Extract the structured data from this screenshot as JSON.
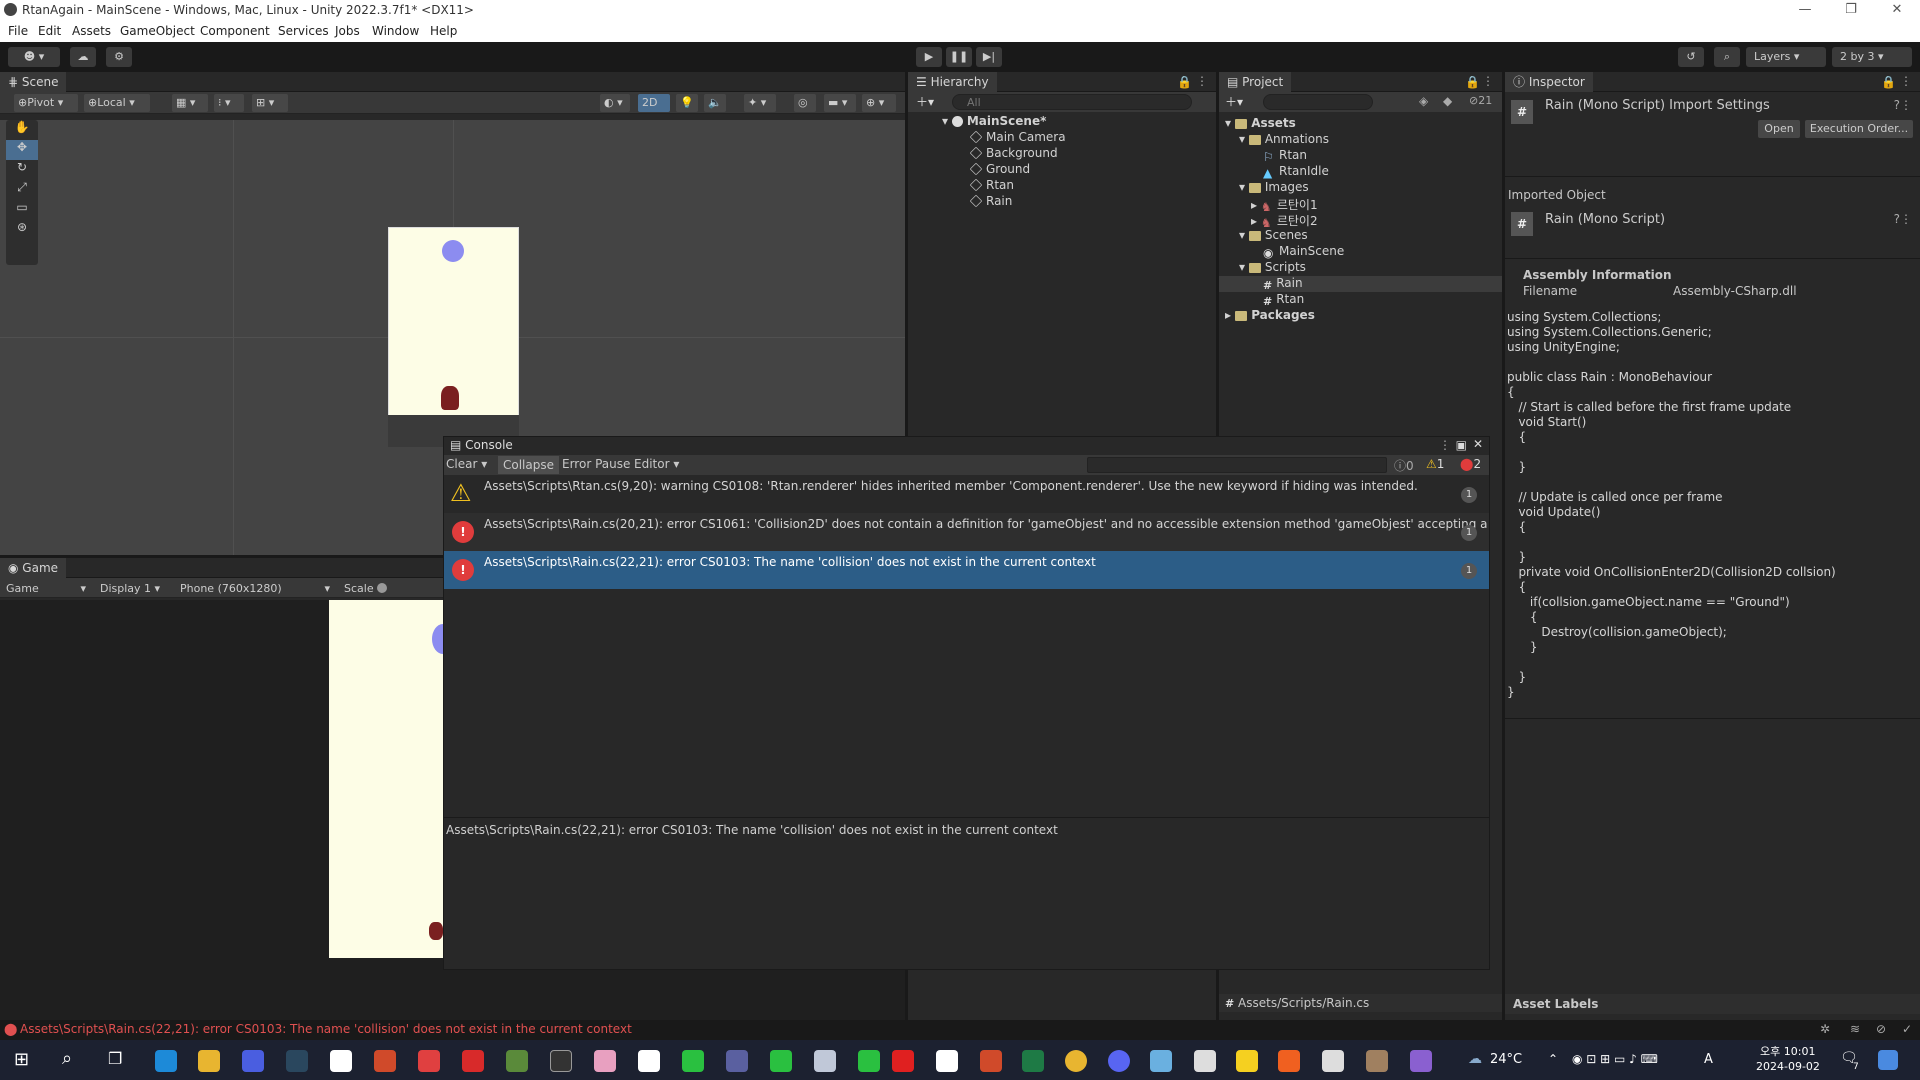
{
  "window": {
    "title": "RtanAgain - MainScene - Windows, Mac, Linux - Unity 2022.3.7f1* <DX11>"
  },
  "menu": [
    "File",
    "Edit",
    "Assets",
    "GameObject",
    "Component",
    "Services",
    "Jobs",
    "Window",
    "Help"
  ],
  "toolbar": {
    "layers": "Layers",
    "layout": "2 by 3"
  },
  "scene": {
    "tab": "Scene",
    "pivot": "Pivot",
    "local": "Local",
    "mode2d": "2D"
  },
  "game": {
    "tab": "Game",
    "view": "Game",
    "display": "Display 1",
    "resolution": "Phone (760x1280)",
    "scale": "Scale"
  },
  "hierarchy": {
    "tab": "Hierarchy",
    "search_placeholder": "All",
    "scene_name": "MainScene*",
    "items": [
      "Main Camera",
      "Background",
      "Ground",
      "Rtan",
      "Rain"
    ]
  },
  "project": {
    "tab": "Project",
    "hidden_count": "21",
    "root": "Assets",
    "tree": {
      "animations": "Anmations",
      "anim_items": [
        "Rtan",
        "RtanIdle"
      ],
      "images": "Images",
      "image_items": [
        "르탄이1",
        "르탄이2"
      ],
      "scenes": "Scenes",
      "scene_items": [
        "MainScene"
      ],
      "scripts": "Scripts",
      "script_items": [
        "Rain",
        "Rtan"
      ],
      "packages": "Packages"
    },
    "footer_path": "Assets/Scripts/Rain.cs"
  },
  "inspector": {
    "tab": "Inspector",
    "title": "Rain (Mono Script) Import Settings",
    "open_label": "Open",
    "exec_order_label": "Execution Order...",
    "imported_object": "Imported Object",
    "object_name": "Rain (Mono Script)",
    "assembly_info": "Assembly Information",
    "filename_label": "Filename",
    "filename_value": "Assembly-CSharp.dll",
    "code": "using System.Collections;\nusing System.Collections.Generic;\nusing UnityEngine;\n\npublic class Rain : MonoBehaviour\n{\n   // Start is called before the first frame update\n   void Start()\n   {\n\n   }\n\n   // Update is called once per frame\n   void Update()\n   {\n\n   }\n   private void OnCollisionEnter2D(Collision2D collsion)\n   {\n      if(collsion.gameObject.name == \"Ground\")\n      {\n         Destroy(collision.gameObject);\n      }\n\n   }\n}",
    "asset_labels": "Asset Labels"
  },
  "console": {
    "title": "Console",
    "clear": "Clear",
    "collapse": "Collapse",
    "error_pause": "Error Pause",
    "editor": "Editor",
    "count_info": "0",
    "count_warn": "1",
    "count_error": "2",
    "rows": [
      {
        "type": "warning",
        "text": "Assets\\Scripts\\Rtan.cs(9,20): warning CS0108: 'Rtan.renderer' hides inherited member 'Component.renderer'. Use the new keyword if hiding was intended.",
        "count": "1"
      },
      {
        "type": "error",
        "text": "Assets\\Scripts\\Rain.cs(20,21): error CS1061: 'Collision2D' does not contain a definition for 'gameObjest' and no accessible extension method 'gameObjest' accepting a first argument",
        "count": "1"
      },
      {
        "type": "error",
        "text": "Assets\\Scripts\\Rain.cs(22,21): error CS0103: The name 'collision' does not exist in the current context",
        "count": "1"
      }
    ],
    "detail": "Assets\\Scripts\\Rain.cs(22,21): error CS0103: The name 'collision' does not exist in the current context"
  },
  "statusbar": {
    "message": "Assets\\Scripts\\Rain.cs(22,21): error CS0103: The name 'collision' does not exist in the current context"
  },
  "taskbar": {
    "weather": "24°C",
    "time": "오후 10:01",
    "date": "2024-09-02",
    "ime": "A",
    "notifications": "7"
  },
  "colors": {
    "selection": "#2c5d87",
    "error": "#e03c3c",
    "warning": "#f0c020"
  }
}
